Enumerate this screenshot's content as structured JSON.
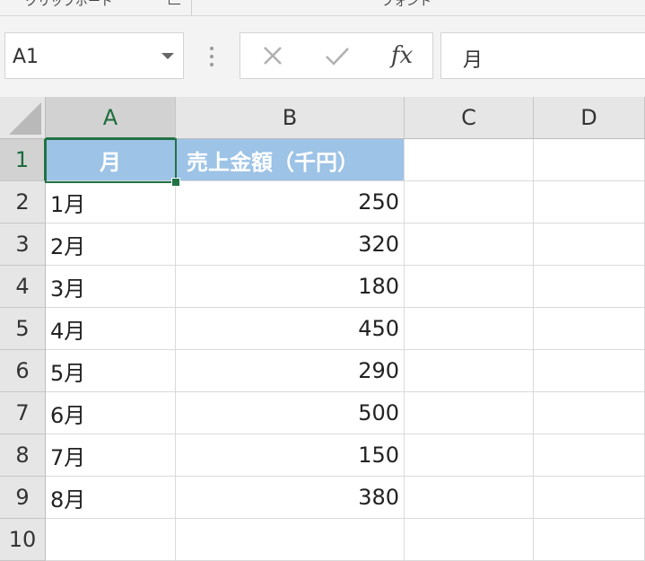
{
  "ribbon": {
    "group_left": "クリップボード",
    "group_right": "フォント"
  },
  "formula_bar": {
    "name_box": "A1",
    "cancel_icon": "close-icon",
    "enter_icon": "check-icon",
    "fx_label": "fx",
    "content": "月"
  },
  "columns": [
    "A",
    "B",
    "C",
    "D"
  ],
  "rows": [
    "1",
    "2",
    "3",
    "4",
    "5",
    "6",
    "7",
    "8",
    "9",
    "10"
  ],
  "table": {
    "headers": [
      "月",
      "売上金額（千円）"
    ],
    "data": [
      [
        "1月",
        "250"
      ],
      [
        "2月",
        "320"
      ],
      [
        "3月",
        "180"
      ],
      [
        "4月",
        "450"
      ],
      [
        "5月",
        "290"
      ],
      [
        "6月",
        "500"
      ],
      [
        "7月",
        "150"
      ],
      [
        "8月",
        "380"
      ]
    ]
  },
  "selection": {
    "active_cell": "A1"
  },
  "colors": {
    "header_fill": "#9dc3e6",
    "selection": "#217346"
  }
}
